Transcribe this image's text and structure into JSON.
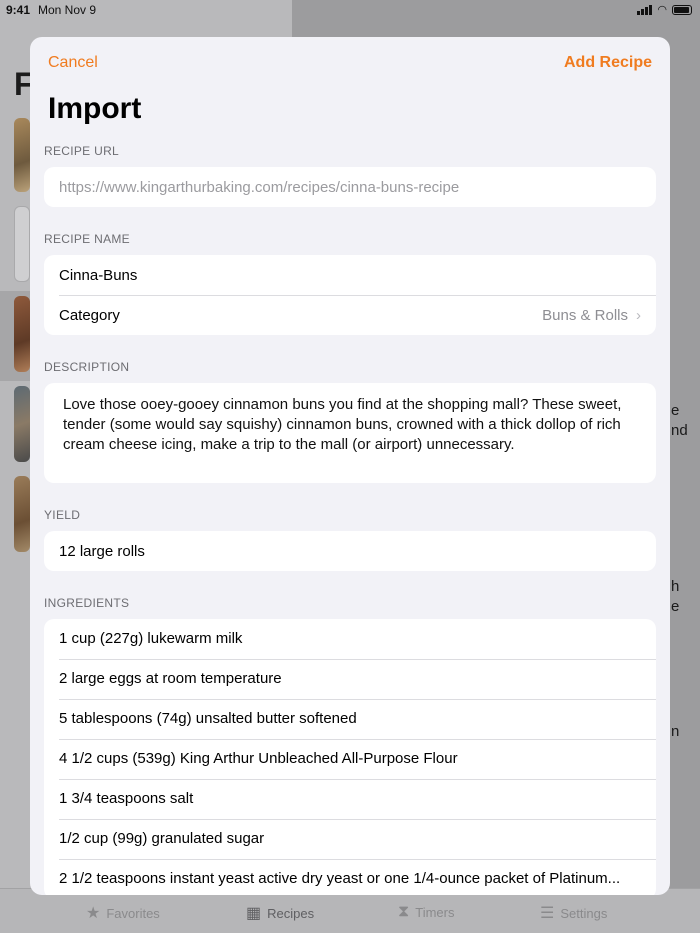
{
  "status": {
    "time": "9:41",
    "date": "Mon Nov 9"
  },
  "background": {
    "big_letter": "F",
    "right_fragments": [
      "e",
      "nd",
      "h",
      "e",
      "n"
    ],
    "tabs": [
      {
        "label": "Favorites",
        "icon": "star-icon"
      },
      {
        "label": "Recipes",
        "icon": "grid-icon"
      },
      {
        "label": "Timers",
        "icon": "hourglass-icon"
      },
      {
        "label": "Settings",
        "icon": "sliders-icon"
      }
    ]
  },
  "sheet": {
    "cancel_label": "Cancel",
    "add_label": "Add Recipe",
    "title": "Import",
    "url_section": {
      "header": "RECIPE URL",
      "placeholder": "https://www.kingarthurbaking.com/recipes/cinna-buns-recipe"
    },
    "name_section": {
      "header": "RECIPE NAME",
      "name": "Cinna-Buns",
      "category_label": "Category",
      "category_value": "Buns & Rolls"
    },
    "description_section": {
      "header": "DESCRIPTION",
      "text": "Love those ooey-gooey cinnamon buns you find at the shopping mall? These sweet, tender (some would say squishy) cinnamon buns, crowned with a thick dollop of rich cream cheese icing, make a trip to the mall (or airport) unnecessary."
    },
    "yield_section": {
      "header": "YIELD",
      "value": "12 large rolls"
    },
    "ingredients_section": {
      "header": "INGREDIENTS",
      "items": [
        "1 cup (227g) lukewarm milk",
        "2 large eggs at room temperature",
        "5 tablespoons (74g) unsalted butter softened",
        "4 1/2 cups (539g) King Arthur Unbleached All-Purpose Flour",
        "1 3/4 teaspoons salt",
        "1/2 cup (99g) granulated sugar",
        "2 1/2 teaspoons instant yeast active dry yeast or one 1/4-ounce packet of Platinum..."
      ]
    }
  },
  "colors": {
    "accent": "#f07c20",
    "sheet_bg": "#f2f2f7"
  }
}
